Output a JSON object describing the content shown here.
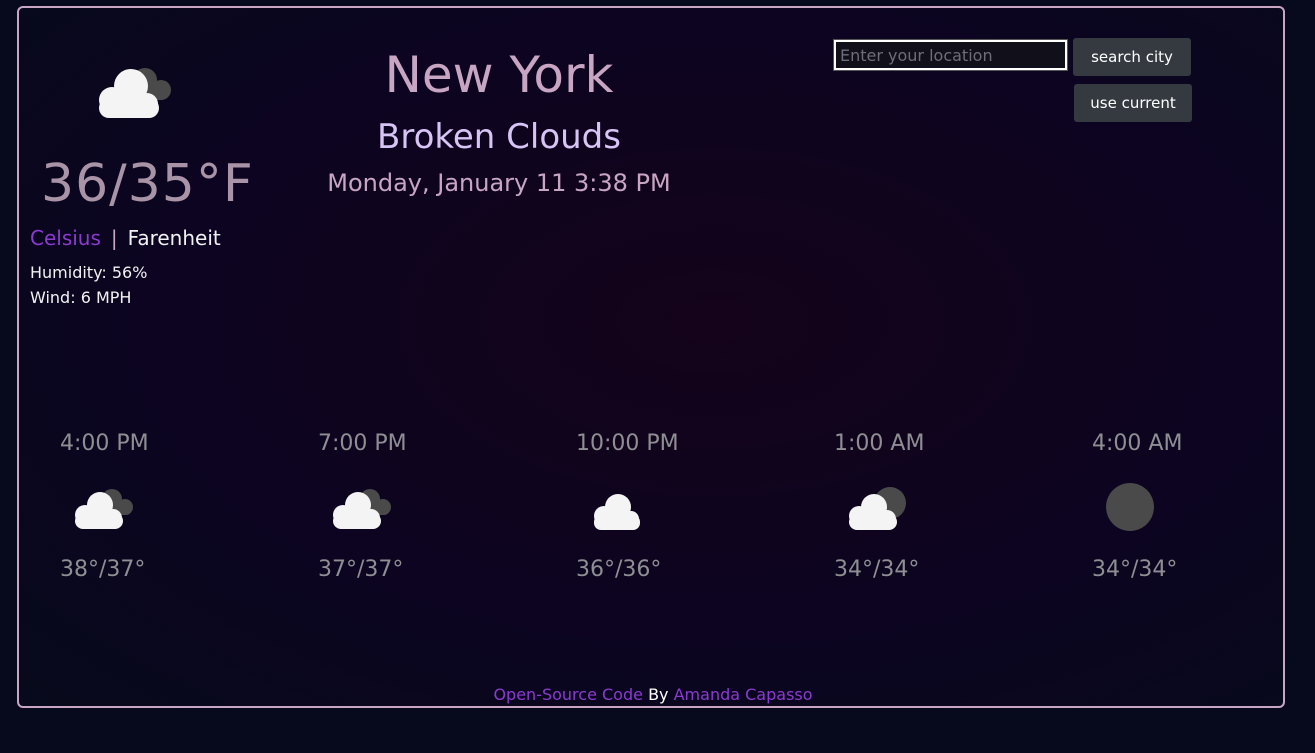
{
  "current": {
    "icon": "broken-clouds-icon",
    "temperature": "36/35°F",
    "units": {
      "celsius_label": "Celsius",
      "separator": "|",
      "fahrenheit_label": "Farenheit"
    },
    "humidity": "Humidity: 56%",
    "wind": "Wind: 6 MPH",
    "city": "New York",
    "description": "Broken Clouds",
    "datetime": "Monday, January 11 3:38 PM"
  },
  "search": {
    "placeholder": "Enter your location",
    "value": "",
    "search_button": "search city",
    "current_button": "use current"
  },
  "forecast": [
    {
      "time": "4:00 PM",
      "icon": "broken-clouds-icon",
      "temps": "38°/37°"
    },
    {
      "time": "7:00 PM",
      "icon": "broken-clouds-icon",
      "temps": "37°/37°"
    },
    {
      "time": "10:00 PM",
      "icon": "cloud-icon",
      "temps": "36°/36°"
    },
    {
      "time": "1:00 AM",
      "icon": "partly-cloudy-night-icon",
      "temps": "34°/34°"
    },
    {
      "time": "4:00 AM",
      "icon": "clear-night-moon-icon",
      "temps": "34°/34°"
    }
  ],
  "footer": {
    "link_text": "Open-Source Code",
    "by_text": "By",
    "author": "Amanda Capasso"
  },
  "colors": {
    "accent_purple": "#8b3bd1",
    "frame_border": "#c8a6c3",
    "button_bg": "#343a40"
  }
}
